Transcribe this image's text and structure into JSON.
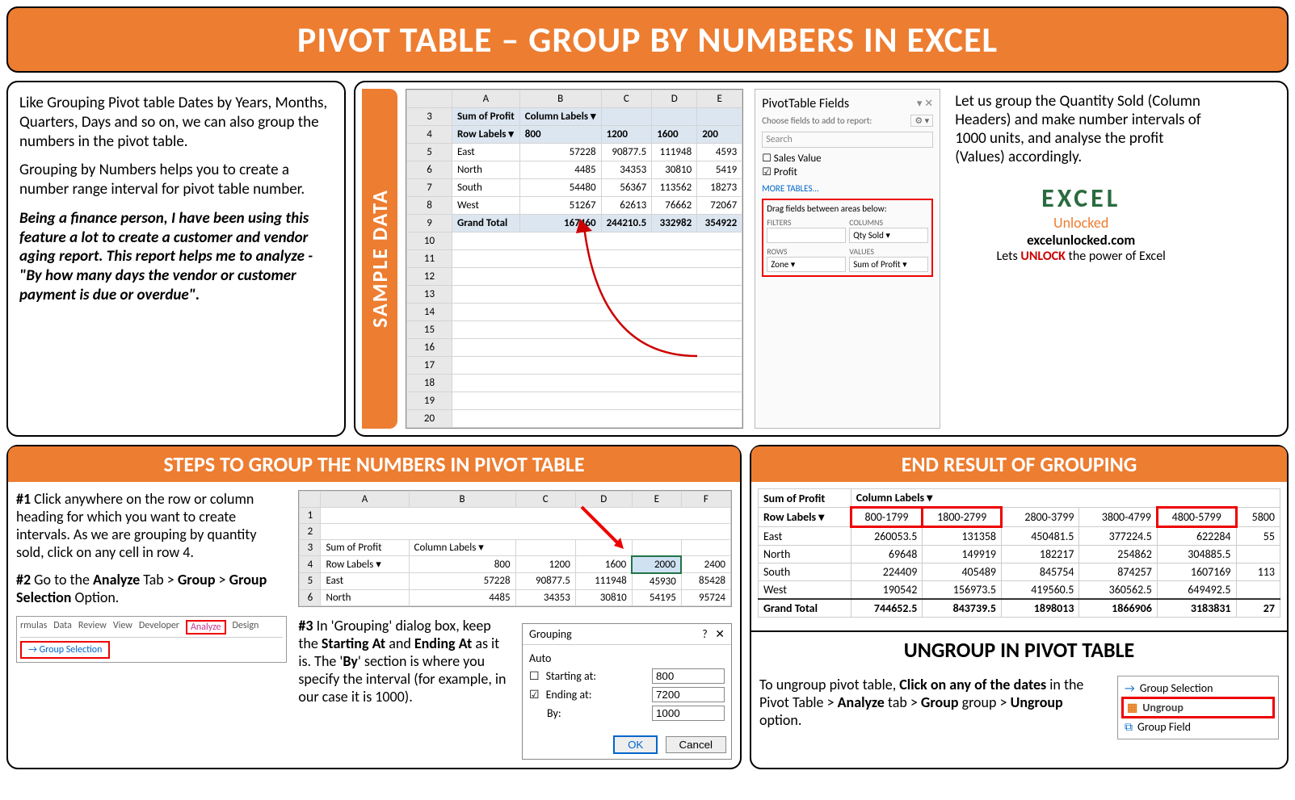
{
  "header": {
    "title": "PIVOT TABLE – GROUP BY NUMBERS IN EXCEL"
  },
  "intro": {
    "p1": "Like Grouping Pivot table Dates by Years, Months, Quarters, Days and so on, we can also group the numbers in the pivot table.",
    "p2": "Grouping by Numbers helps you to create a number range interval for pivot table number.",
    "p3": "Being a finance person, I have been using this feature a lot to create a customer and vendor aging report. This report helps me to analyze - \"By how many days the vendor or customer payment is due or overdue\"."
  },
  "sample": {
    "tab_label": "SAMPLE DATA",
    "cols": [
      "",
      "A",
      "B",
      "C",
      "D",
      "E"
    ],
    "rows": [
      [
        "3",
        "Sum of Profit",
        "Column Labels ▾",
        "",
        "",
        ""
      ],
      [
        "4",
        "Row Labels ▾",
        "800",
        "1200",
        "1600",
        "200"
      ],
      [
        "5",
        "East",
        "57228",
        "90877.5",
        "111948",
        "4593"
      ],
      [
        "6",
        "North",
        "4485",
        "34353",
        "30810",
        "5419"
      ],
      [
        "7",
        "South",
        "54480",
        "56367",
        "113562",
        "18273"
      ],
      [
        "8",
        "West",
        "51267",
        "62613",
        "76662",
        "72067"
      ],
      [
        "9",
        "Grand Total",
        "167460",
        "244210.5",
        "332982",
        "354922"
      ]
    ],
    "fields": {
      "title": "PivotTable Fields",
      "sub": "Choose fields to add to report:",
      "search": "Search",
      "list": [
        {
          "label": "Sales Value",
          "checked": false
        },
        {
          "label": "Profit",
          "checked": true
        }
      ],
      "more": "MORE TABLES...",
      "drag": "Drag fields between areas below:",
      "filters_h": "FILTERS",
      "columns_h": "COLUMNS",
      "rows_h": "ROWS",
      "values_h": "VALUES",
      "columns_v": "Qty Sold ▾",
      "rows_v": "Zone ▾",
      "values_v": "Sum of Profit ▾"
    },
    "right": {
      "p": "Let us group the Quantity Sold (Column Headers) and make number intervals of 1000 units, and analyse the profit (Values) accordingly.",
      "logo1": "EXCEL",
      "logo2": "Unlocked",
      "url": "excelunlocked.com",
      "tag_pre": "Lets ",
      "tag_bold": "UNLOCK",
      "tag_post": " the power of Excel"
    }
  },
  "steps": {
    "heading": "STEPS TO GROUP THE NUMBERS IN PIVOT TABLE",
    "s1_lead": "#1 ",
    "s1": "Click anywhere on the row or column heading for which you want to create intervals. As we are grouping by quantity sold, click on any cell in row 4.",
    "s2_lead": "#2 ",
    "s2a": "Go to the ",
    "s2b": "Analyze",
    "s2c": " Tab > ",
    "s2d": "Group",
    "s2e": " > ",
    "s2f": "Group Selection",
    "s2g": " Option.",
    "ribbon_tabs": [
      "rmulas",
      "Data",
      "Review",
      "View",
      "Developer",
      "Analyze",
      "Design"
    ],
    "ribbon_btn": "→ Group Selection",
    "grid_cols": [
      "",
      "A",
      "B",
      "C",
      "D",
      "E",
      "F"
    ],
    "grid_rows": [
      [
        "1",
        "",
        "",
        "",
        "",
        "",
        ""
      ],
      [
        "2",
        "",
        "",
        "",
        "",
        "",
        ""
      ],
      [
        "3",
        "Sum of Profit",
        "Column Labels ▾",
        "",
        "",
        "",
        ""
      ],
      [
        "4",
        "Row Labels ▾",
        "800",
        "1200",
        "1600",
        "2000",
        "2400"
      ],
      [
        "5",
        "East",
        "57228",
        "90877.5",
        "111948",
        "45930",
        "85428"
      ],
      [
        "6",
        "North",
        "4485",
        "34353",
        "30810",
        "54195",
        "95724"
      ]
    ],
    "s3_lead": "#3 ",
    "s3a": "In 'Grouping' dialog box, keep the ",
    "s3b": "Starting At",
    "s3c": " and ",
    "s3d": "Ending At",
    "s3e": " as it is. The '",
    "s3f": "By",
    "s3g": "' section is where you specify the interval (for example, in our case it is 1000).",
    "dialog": {
      "title": "Grouping",
      "auto": "Auto",
      "starting": "Starting at:",
      "starting_v": "800",
      "ending": "Ending at:",
      "ending_v": "7200",
      "by": "By:",
      "by_v": "1000",
      "ok": "OK",
      "cancel": "Cancel"
    }
  },
  "endres": {
    "heading": "END RESULT OF GROUPING",
    "table": {
      "h1": "Sum of Profit",
      "h2": "Column Labels ▾",
      "rowlbl": "Row Labels ▾",
      "cols": [
        "800-1799",
        "1800-2799",
        "2800-3799",
        "3800-4799",
        "4800-5799",
        "5800"
      ],
      "rows": [
        [
          "East",
          "260053.5",
          "131358",
          "450481.5",
          "377224.5",
          "622284",
          "55"
        ],
        [
          "North",
          "69648",
          "149919",
          "182217",
          "254862",
          "304885.5",
          ""
        ],
        [
          "South",
          "224409",
          "405489",
          "845754",
          "874257",
          "1607169",
          "113"
        ],
        [
          "West",
          "190542",
          "156973.5",
          "419560.5",
          "360562.5",
          "649492.5",
          ""
        ],
        [
          "Grand Total",
          "744652.5",
          "843739.5",
          "1898013",
          "1866906",
          "3183831",
          "27"
        ]
      ]
    }
  },
  "ungroup": {
    "heading": "UNGROUP IN PIVOT TABLE",
    "p_a": "To ungroup pivot table, ",
    "p_b": "Click on any of the dates",
    "p_c": " in the Pivot Table > ",
    "p_d": "Analyze",
    "p_e": " tab > ",
    "p_f": "Group",
    "p_g": " group > ",
    "p_h": "Ungroup",
    "p_i": " option.",
    "menu": [
      "Group Selection",
      "Ungroup",
      "Group Field"
    ]
  }
}
